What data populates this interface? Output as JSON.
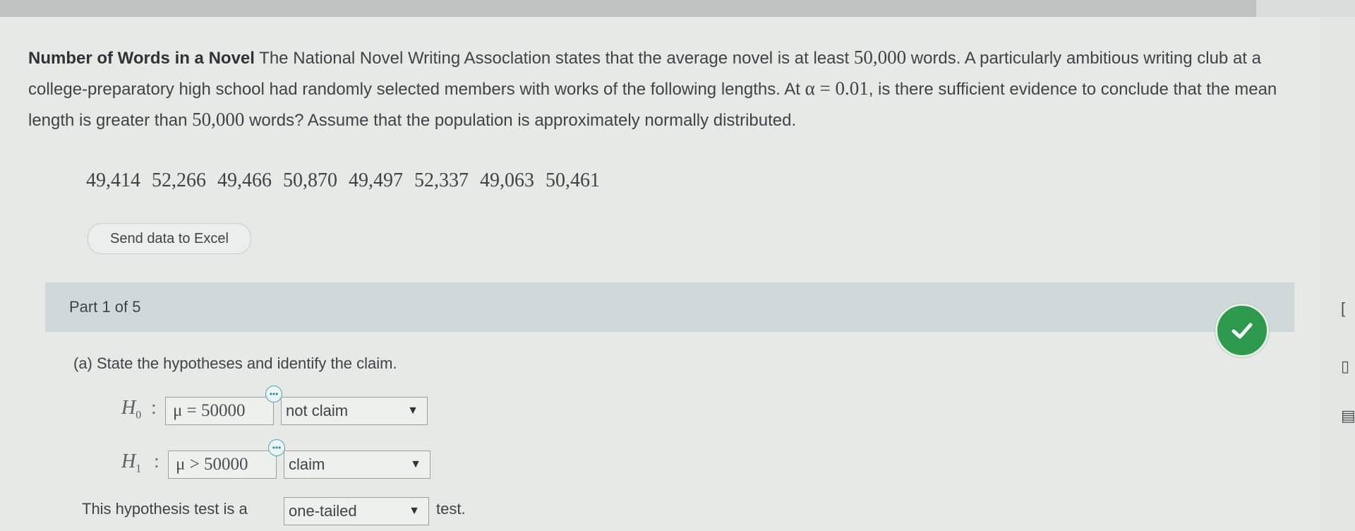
{
  "problem": {
    "title": "Number of Words in a Novel",
    "seg1": " The National Novel Writing Assoclation states that the average novel is at least ",
    "num1": "50,000",
    "seg2": " words. A particularly ambitious writing club at a college-preparatory high school had randomly selected members with works of the following lengths. At ",
    "alpha": "α = 0.01",
    "seg3": ", is there sufficient evidence to conclude that the mean length is greater than ",
    "num2": "50,000",
    "seg4": " words? Assume that the population is approximately normally distributed."
  },
  "data_values": [
    "49,414",
    "52,266",
    "49,466",
    "50,870",
    "49,497",
    "52,337",
    "49,063",
    "50,461"
  ],
  "excel_button": "Send data to Excel",
  "part": {
    "label": "Part 1 of 5"
  },
  "question": "(a) State the hypotheses and identify the claim.",
  "h0": {
    "symbol": "H",
    "sub": "0",
    "colon": ":",
    "expr": "μ = 50000",
    "claim": "not claim"
  },
  "h1": {
    "symbol": "H",
    "sub": "1",
    "colon": ":",
    "expr": "μ > 50000",
    "claim": "claim"
  },
  "tail": {
    "prefix": "This hypothesis test is a",
    "value": "one-tailed",
    "suffix": "test."
  },
  "icons": {
    "edit": "ellipsis-icon",
    "check": "check-icon",
    "caret": "▼"
  },
  "colors": {
    "check_green": "#2e9a4e",
    "part_bar": "#cfd9da"
  }
}
